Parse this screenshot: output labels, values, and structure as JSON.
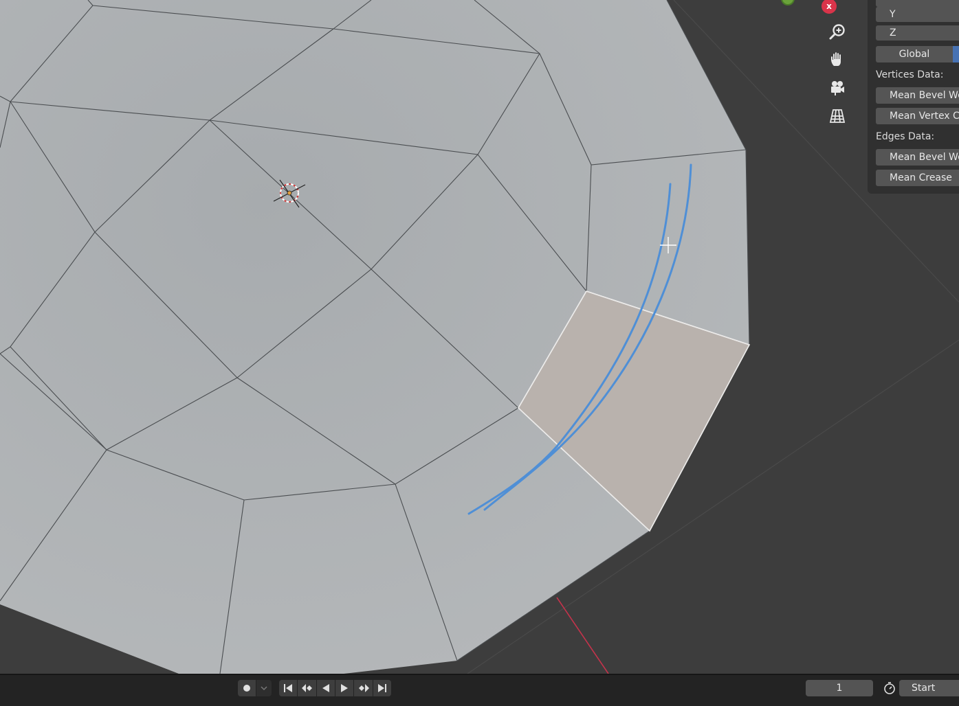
{
  "panel": {
    "axis_y": "Y",
    "axis_z": "Z",
    "global_label": "Global",
    "vertices_data_label": "Vertices Data:",
    "mean_bevel_weight_v": "Mean Bevel We",
    "mean_vertex_crease": "Mean Vertex C",
    "edges_data_label": "Edges Data:",
    "mean_bevel_weight_e": "Mean Bevel We",
    "mean_crease": "Mean Crease"
  },
  "navigation": {
    "close_glyph": "x",
    "icons": [
      "zoom-icon",
      "hand-pan-icon",
      "camera-icon",
      "grid-ortho-icon"
    ]
  },
  "timeline": {
    "current_frame": "1",
    "start_label": "Start"
  },
  "colors": {
    "mesh_face": "#a9adb0",
    "selected_face": "#b9b2ad",
    "annotation_stroke": "#4f8fd6",
    "x_axis_line": "#c4334b",
    "background": "#3d3d3d",
    "accent": "#4772b3"
  }
}
